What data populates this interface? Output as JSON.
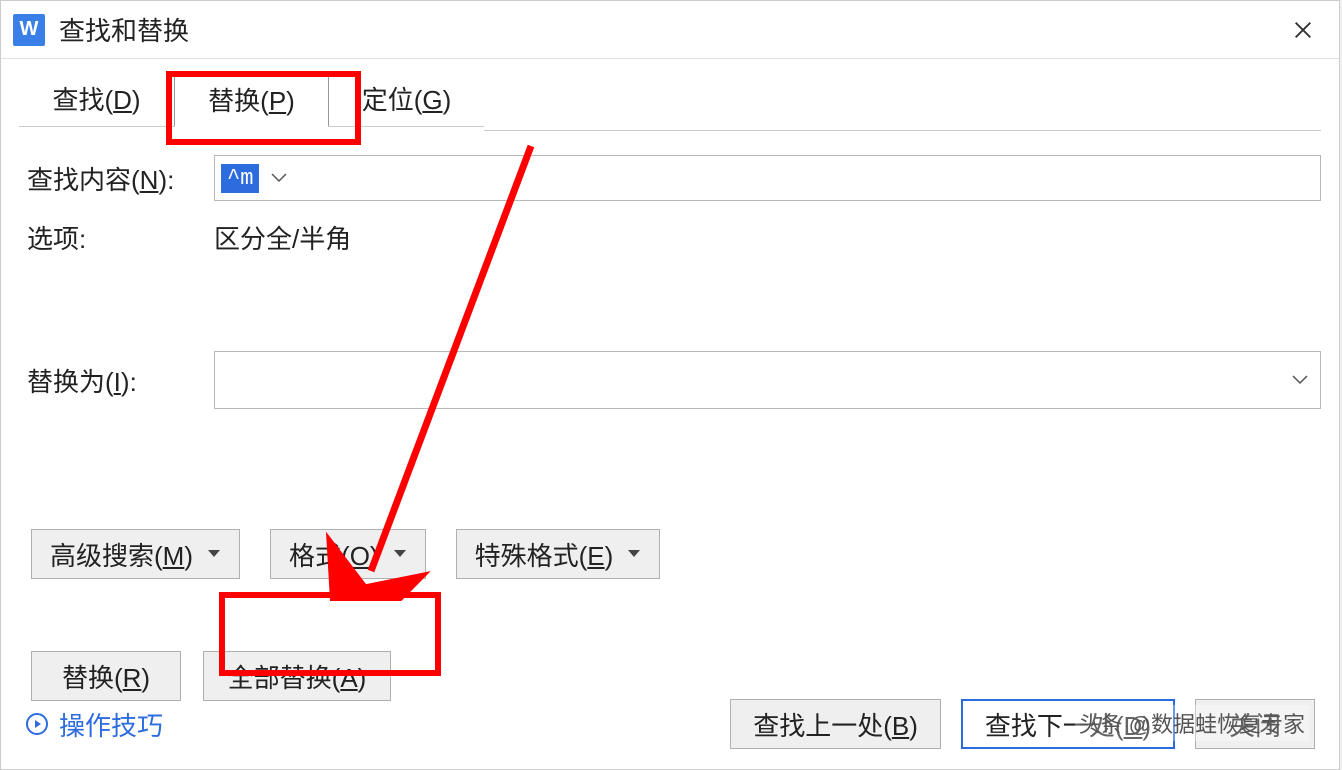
{
  "window": {
    "title": "查找和替换",
    "app_icon_letter": "W"
  },
  "tabs": {
    "find": "查找(D)",
    "replace": "替换(P)",
    "goto": "定位(G)"
  },
  "form": {
    "find_label": "查找内容(N):",
    "find_value": "^m",
    "options_label": "选项:",
    "options_value": "区分全/半角",
    "replace_label": "替换为(I):",
    "replace_value": ""
  },
  "dropdowns": {
    "advanced": "高级搜索(M)",
    "format": "格式(O)",
    "special": "特殊格式(E)"
  },
  "actions": {
    "replace": "替换(R)",
    "replace_all": "全部替换(A)"
  },
  "footer": {
    "tips": "操作技巧",
    "find_prev": "查找上一处(B)",
    "find_next": "查找下一处(D)",
    "close": "关闭"
  },
  "watermark": "头条 @数据蛙恢复专家",
  "colors": {
    "highlight_red": "#ff0000",
    "link_blue": "#2d6cdf"
  }
}
